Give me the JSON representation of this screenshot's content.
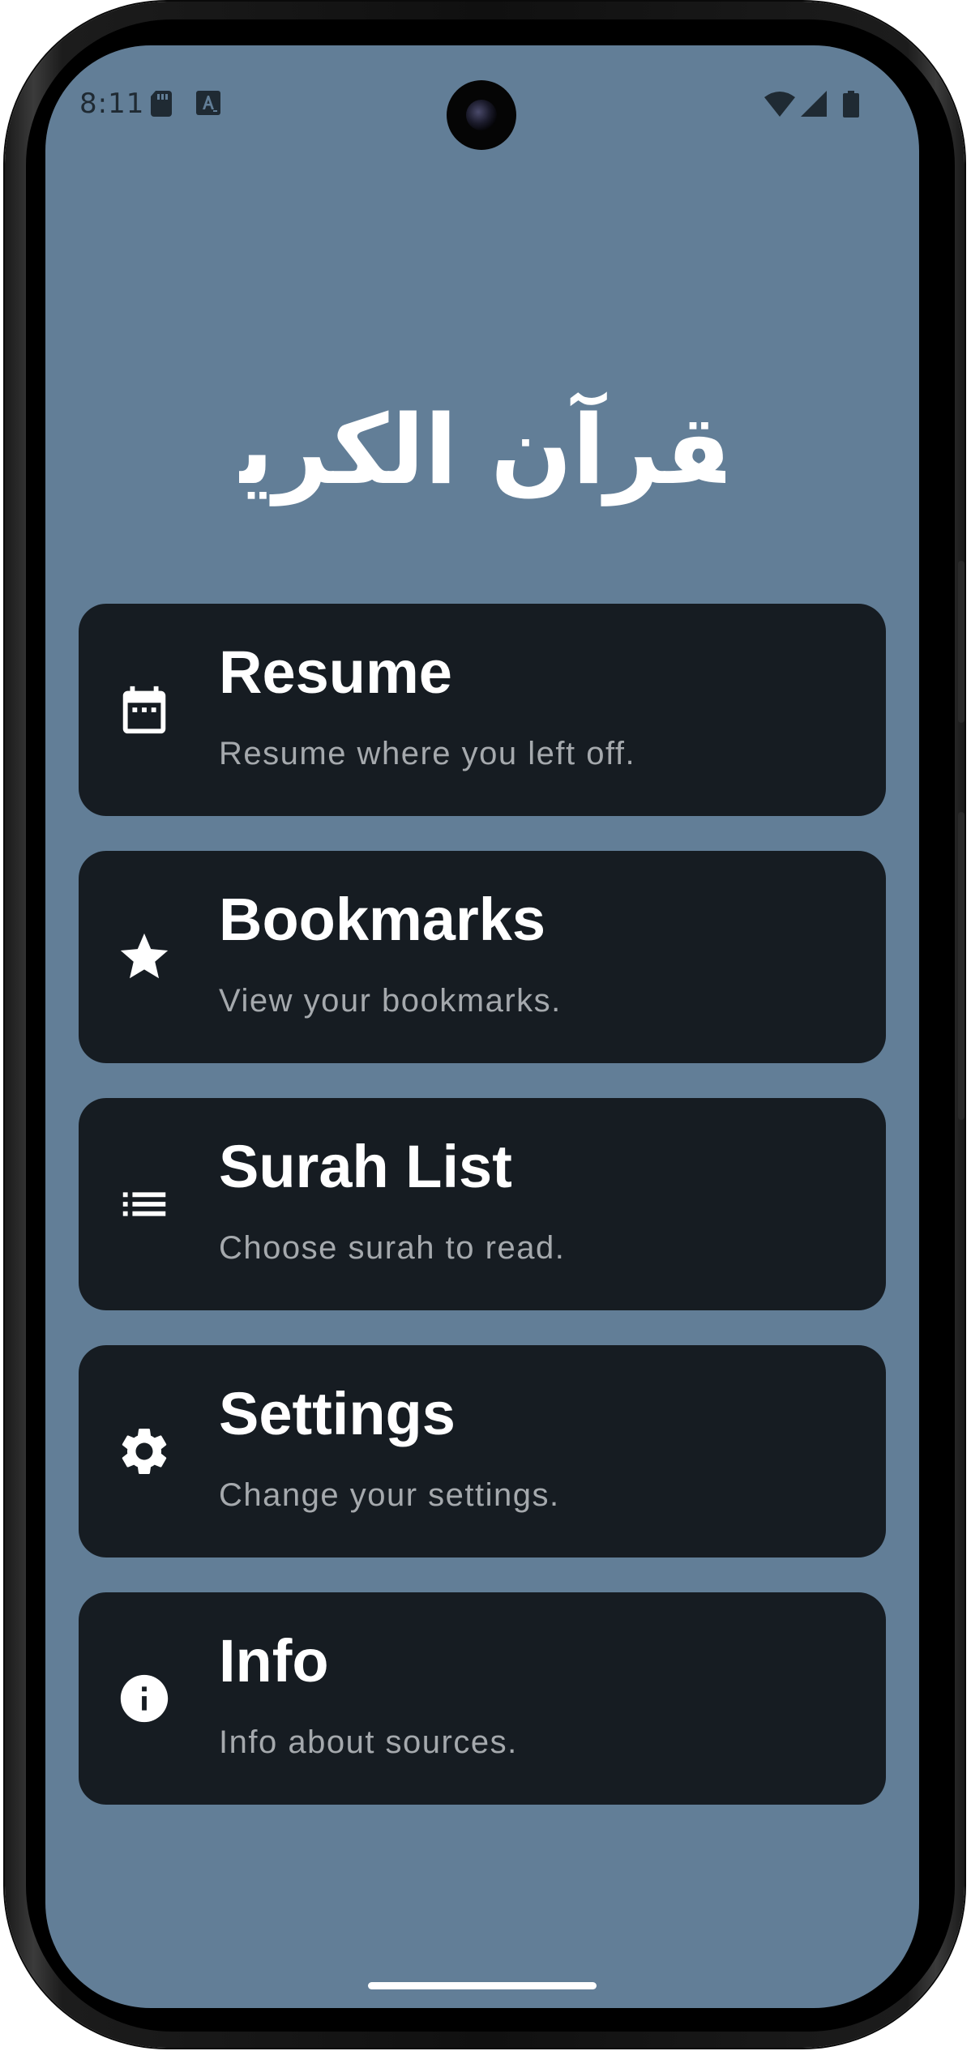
{
  "colors": {
    "screen_background": "#627e97",
    "card_background": "#161c22",
    "title_text": "#ffffff",
    "subtitle_text": "#a5a9ad",
    "status_text": "#1f2a33",
    "home_indicator": "#ffffff"
  },
  "status_bar": {
    "time": "8:11",
    "left_icons": [
      "sd-card-icon",
      "text-notification-icon"
    ],
    "right_icons": [
      "wifi-icon",
      "signal-icon",
      "battery-icon"
    ]
  },
  "header": {
    "logo_text": "القرآن الكريم"
  },
  "menu": {
    "items": [
      {
        "icon": "calendar-icon",
        "title": "Resume",
        "subtitle": "Resume where you left off."
      },
      {
        "icon": "star-icon",
        "title": "Bookmarks",
        "subtitle": "View your bookmarks."
      },
      {
        "icon": "list-icon",
        "title": "Surah List",
        "subtitle": "Choose surah to read."
      },
      {
        "icon": "gear-icon",
        "title": "Settings",
        "subtitle": "Change your settings."
      },
      {
        "icon": "info-icon",
        "title": "Info",
        "subtitle": "Info about sources."
      }
    ]
  }
}
